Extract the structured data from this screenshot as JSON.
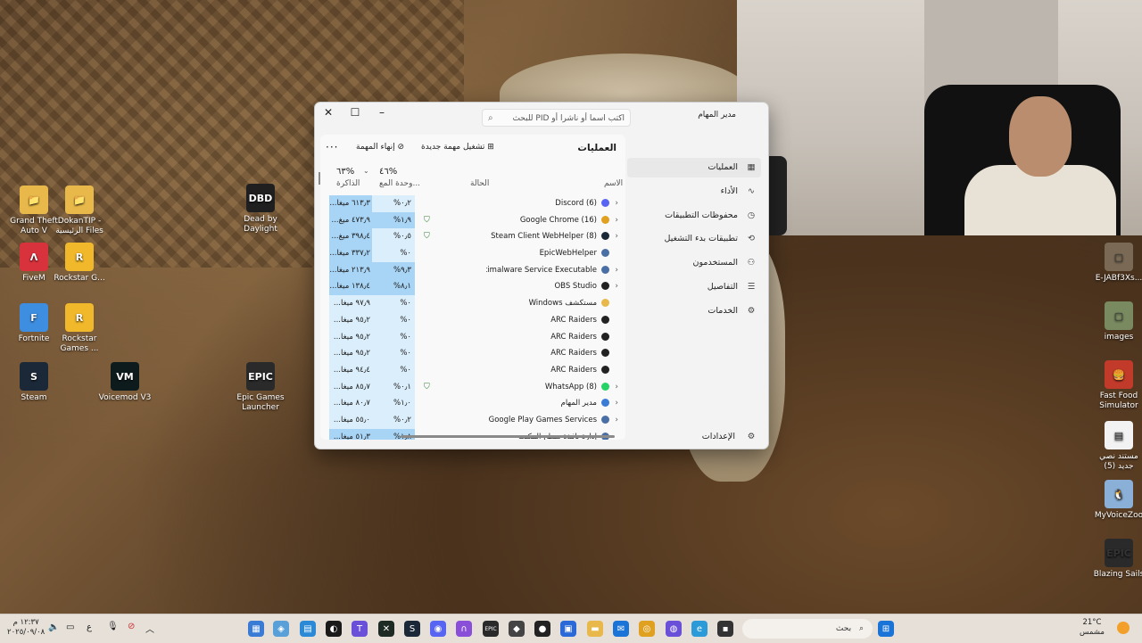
{
  "desktop": {
    "icons_left": [
      {
        "label": "Grand Theft Auto V",
        "glyph": "📁",
        "color": "#e8b94a"
      },
      {
        "label": "DokanTIP - الرئيسية Files",
        "glyph": "📁",
        "color": "#e8b94a"
      },
      {
        "label": "FiveM",
        "glyph": "Λ",
        "color": "#d8323c"
      },
      {
        "label": "Rockstar G...",
        "glyph": "R",
        "color": "#f0b82a"
      },
      {
        "label": "Fortnite",
        "glyph": "F",
        "color": "#3d8de0"
      },
      {
        "label": "Rockstar Games ...",
        "glyph": "R",
        "color": "#f0b82a"
      },
      {
        "label": "Steam",
        "glyph": "S",
        "color": "#1b2838"
      },
      {
        "label": "Voicemod V3",
        "glyph": "VM",
        "color": "#0e1b1d"
      },
      {
        "label": "Dead by Daylight",
        "glyph": "DBD",
        "color": "#1f1f1f"
      },
      {
        "label": "Epic Games Launcher",
        "glyph": "EPIC",
        "color": "#2a2a2a"
      }
    ],
    "icons_right": [
      {
        "label": "E-JABf3Xs...",
        "glyph": "▢",
        "color": "#7a6a55"
      },
      {
        "label": "images",
        "glyph": "▢",
        "color": "#7a8a60"
      },
      {
        "label": "Fast Food Simulator",
        "glyph": "🍔",
        "color": "#c23a2a"
      },
      {
        "label": "مستند نصي جديد (5)",
        "glyph": "▤",
        "color": "#f2f2f2"
      },
      {
        "label": "MyVoiceZoo",
        "glyph": "🐧",
        "color": "#8ab0d8"
      },
      {
        "label": "Blazing Sails",
        "glyph": "EPIC",
        "color": "#2a2a2a"
      }
    ]
  },
  "task_manager": {
    "app_title": "مدير المهام",
    "search_placeholder": "اكتب اسما أو ناشرا أو PID للبحث",
    "window_buttons": {
      "minimize": "–",
      "maximize": "☐",
      "close": "✕"
    },
    "nav": [
      {
        "label": "العمليات",
        "icon": "processes-icon",
        "glyph": "▦",
        "active": true
      },
      {
        "label": "الأداء",
        "icon": "performance-icon",
        "glyph": "∿",
        "active": false
      },
      {
        "label": "محفوظات التطبيقات",
        "icon": "history-icon",
        "glyph": "◷",
        "active": false
      },
      {
        "label": "تطبيقات بدء التشغيل",
        "icon": "startup-icon",
        "glyph": "⟲",
        "active": false
      },
      {
        "label": "المستخدمون",
        "icon": "users-icon",
        "glyph": "⚇",
        "active": false
      },
      {
        "label": "التفاصيل",
        "icon": "details-icon",
        "glyph": "☰",
        "active": false
      },
      {
        "label": "الخدمات",
        "icon": "services-icon",
        "glyph": "⚙",
        "active": false
      }
    ],
    "settings_label": "الإعدادات",
    "toolbar": {
      "title": "العمليات",
      "run_new_task": "تشغيل مهمة جديدة",
      "end_task": "إنهاء المهمة",
      "more": "···"
    },
    "columns": {
      "name": "الاسم",
      "status": "الحالة",
      "cpu_pct": "٤٦%",
      "cpu_label": "وحدة المع...",
      "mem_pct": "٦٣%",
      "mem_label": "الذاكرة"
    },
    "rows": [
      {
        "name": "Discord (6)",
        "expand": true,
        "icon_color": "#5865f2",
        "status": "",
        "cpu": "٠٫٢%",
        "mem": "٦١٣٫٣ ميغا...",
        "cpu_hi": false,
        "mem_hi": true
      },
      {
        "name": "Google Chrome (16)",
        "expand": true,
        "icon_color": "#e0a020",
        "status": "leaf",
        "cpu": "١٫٩%",
        "mem": "٤٧٣٫٩ ميغ...",
        "cpu_hi": true,
        "mem_hi": true
      },
      {
        "name": "Steam Client WebHelper (8)",
        "expand": true,
        "icon_color": "#1b2838",
        "status": "leaf",
        "cpu": "٠٫٥%",
        "mem": "٣٩٨٫٤ ميغ...",
        "cpu_hi": false,
        "mem_hi": true
      },
      {
        "name": "EpicWebHelper",
        "expand": false,
        "icon_color": "#4a6fa5",
        "status": "",
        "cpu": "٠%",
        "mem": "٣٣٧٫٢ ميغا...",
        "cpu_hi": false,
        "mem_hi": true
      },
      {
        "name": "Antimalware Service Executable",
        "expand": true,
        "icon_color": "#4a6fa5",
        "status": "",
        "cpu": "٩٫٣%",
        "mem": "٢١٣٫٩ ميغا...",
        "cpu_hi": true,
        "mem_hi": true
      },
      {
        "name": "OBS Studio",
        "expand": true,
        "icon_color": "#222",
        "status": "",
        "cpu": "٨٫١%",
        "mem": "١٣٨٫٤ ميغا...",
        "cpu_hi": true,
        "mem_hi": true
      },
      {
        "name": "مستكشف Windows",
        "expand": false,
        "icon_color": "#e8b94a",
        "status": "",
        "cpu": "٠%",
        "mem": "٩٧٫٩ ميغا...",
        "cpu_hi": false,
        "mem_hi": false
      },
      {
        "name": "ARC Raiders",
        "expand": false,
        "icon_color": "#222",
        "status": "",
        "cpu": "٠%",
        "mem": "٩٥٫٢ ميغا...",
        "cpu_hi": false,
        "mem_hi": false
      },
      {
        "name": "ARC Raiders",
        "expand": false,
        "icon_color": "#222",
        "status": "",
        "cpu": "٠%",
        "mem": "٩٥٫٢ ميغا...",
        "cpu_hi": false,
        "mem_hi": false
      },
      {
        "name": "ARC Raiders",
        "expand": false,
        "icon_color": "#222",
        "status": "",
        "cpu": "٠%",
        "mem": "٩٥٫٢ ميغا...",
        "cpu_hi": false,
        "mem_hi": false
      },
      {
        "name": "ARC Raiders",
        "expand": false,
        "icon_color": "#222",
        "status": "",
        "cpu": "٠%",
        "mem": "٩٤٫٤ ميغا...",
        "cpu_hi": false,
        "mem_hi": false
      },
      {
        "name": "WhatsApp (8)",
        "expand": true,
        "icon_color": "#25d366",
        "status": "leaf",
        "cpu": "٠٫١%",
        "mem": "٨٥٫٧ ميغا...",
        "cpu_hi": false,
        "mem_hi": false
      },
      {
        "name": "مدير المهام",
        "expand": true,
        "icon_color": "#3a7bd5",
        "status": "",
        "cpu": "١٫٠%",
        "mem": "٨٠٫٧ ميغا...",
        "cpu_hi": false,
        "mem_hi": false
      },
      {
        "name": "Google Play Games Services",
        "expand": true,
        "icon_color": "#4a6fa5",
        "status": "",
        "cpu": "٠٫٢%",
        "mem": "٥٥٫٠ ميغا...",
        "cpu_hi": false,
        "mem_hi": false
      },
      {
        "name": "إدارة نافذة سطح المكتب",
        "expand": false,
        "icon_color": "#4a6fa5",
        "status": "",
        "cpu": "١٫٨%",
        "mem": "٥١٫٣ ميغا...",
        "cpu_hi": true,
        "mem_hi": true
      }
    ]
  },
  "taskbar": {
    "search_placeholder": "بحث",
    "clock_time": "١٢:٣٧ م",
    "clock_date": "٢٠٢٥/٠٩/٠٨",
    "weather_temp": "21°C",
    "weather_desc": "مشمس",
    "lang": "ع"
  }
}
